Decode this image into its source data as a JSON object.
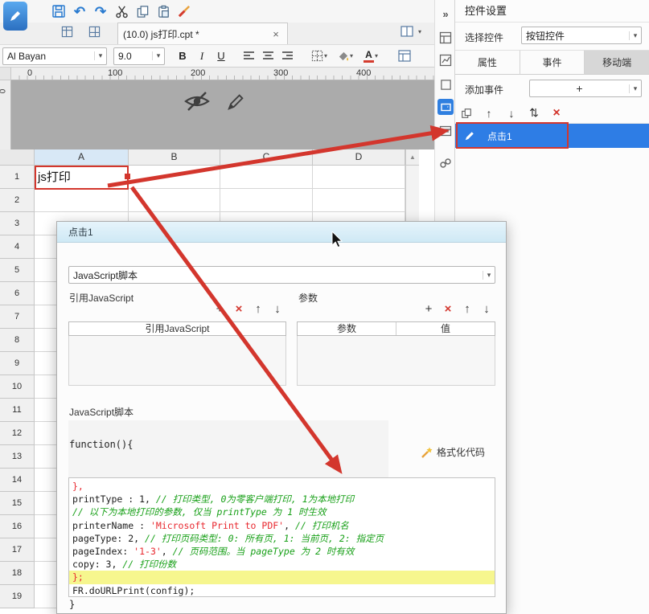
{
  "colors": {
    "accent_blue": "#2e7de5",
    "annotation_red": "#d3362d",
    "selected_column_header": "#d8e8f6",
    "dialog_title_bg": "#cfe9f5",
    "code_comment_green": "#18a018",
    "code_red": "#e8282f",
    "highlight_line_yellow": "#f6f68e"
  },
  "icons": {
    "undo": "↶",
    "redo": "↷",
    "caret_down": "▾",
    "collapse_right": "»",
    "plus": "+",
    "delete_x": "×",
    "arrow_up": "↑",
    "arrow_down": "↓",
    "sort": "⇅",
    "scroll_up": "▲",
    "close_tab": "×"
  },
  "tab_bar": {
    "active_tab": "(10.0) js打印.cpt *"
  },
  "font_bar": {
    "font_family_value": "Al Bayan",
    "font_size_value": "9.0",
    "bold_label": "B",
    "italic_label": "I",
    "underline_label": "U"
  },
  "ruler": {
    "h_marks": [
      "0",
      "100",
      "200",
      "300",
      "400"
    ],
    "v_mark": "0"
  },
  "sheet": {
    "columns": [
      "A",
      "B",
      "C",
      "D"
    ],
    "row_count": 19,
    "cell_a1": "js打印"
  },
  "side_panel": {
    "title": "控件设置",
    "select_widget_label": "选择控件",
    "select_widget_value": "按钮控件",
    "tabs": [
      {
        "key": "properties",
        "label": "属性"
      },
      {
        "key": "events",
        "label": "事件"
      },
      {
        "key": "mobile",
        "label": "移动端"
      }
    ],
    "add_event_label": "添加事件",
    "event_item_label": "点击1"
  },
  "dialog": {
    "title": "点击1",
    "event_type_value": "JavaScript脚本",
    "ref_js_section_label": "引用JavaScript",
    "params_section_label": "参数",
    "ref_js_table_header": "引用JavaScript",
    "params_table_headers": [
      "参数",
      "值"
    ],
    "script_label": "JavaScript脚本",
    "format_button_label": "格式化代码",
    "code": {
      "opening_line": "function(){",
      "closing_line": "}",
      "lines": [
        {
          "segments": [
            {
              "t": "},",
              "c": "red"
            }
          ]
        },
        {
          "segments": [
            {
              "t": "printType : 1, ",
              "c": "plain"
            },
            {
              "t": "// 打印类型, 0为零客户端打印, 1为本地打印",
              "c": "comment"
            }
          ]
        },
        {
          "segments": [
            {
              "t": "// 以下为本地打印的参数, 仅当 printType 为 1 时生效",
              "c": "comment"
            }
          ]
        },
        {
          "segments": [
            {
              "t": "printerName : ",
              "c": "plain"
            },
            {
              "t": "'Microsoft Print to PDF'",
              "c": "string"
            },
            {
              "t": ", ",
              "c": "plain"
            },
            {
              "t": "// 打印机名",
              "c": "comment"
            }
          ]
        },
        {
          "segments": [
            {
              "t": "pageType: 2, ",
              "c": "plain"
            },
            {
              "t": "// 打印页码类型: 0: 所有页, 1: 当前页, 2: 指定页",
              "c": "comment"
            }
          ]
        },
        {
          "segments": [
            {
              "t": "pageIndex: ",
              "c": "plain"
            },
            {
              "t": "'1-3'",
              "c": "string"
            },
            {
              "t": ", ",
              "c": "plain"
            },
            {
              "t": "// 页码范围。当 pageType 为 2 时有效",
              "c": "comment"
            }
          ]
        },
        {
          "segments": [
            {
              "t": "copy: 3, ",
              "c": "plain"
            },
            {
              "t": "// 打印份数",
              "c": "comment"
            }
          ]
        },
        {
          "segments": [
            {
              "t": "};",
              "c": "red"
            }
          ],
          "highlight": true
        },
        {
          "segments": [
            {
              "t": "FR.doURLPrint(config);",
              "c": "plain"
            }
          ]
        }
      ]
    }
  }
}
